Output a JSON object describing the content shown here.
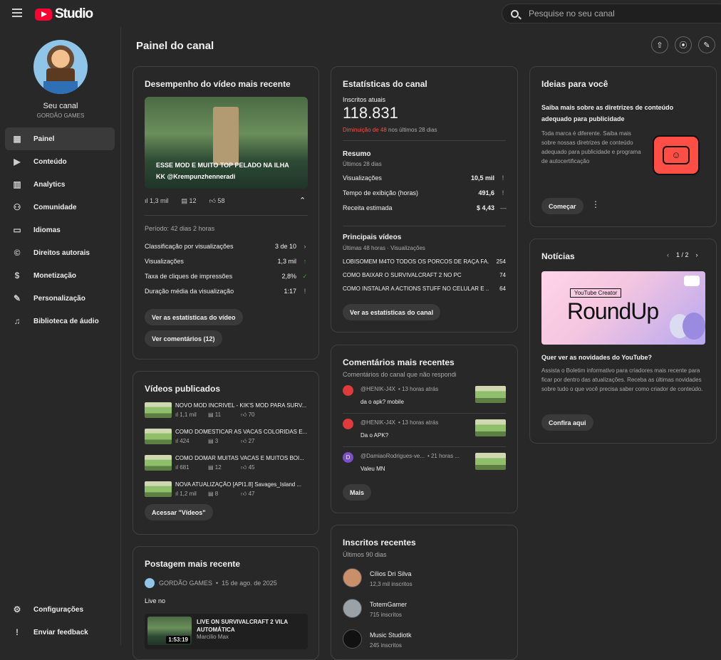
{
  "app": {
    "logo_text": "Studio",
    "search_placeholder": "Pesquise no seu canal"
  },
  "sidebar": {
    "channel_label": "Seu canal",
    "channel_name": "GORDÃO GAMES",
    "items": [
      {
        "label": "Painel",
        "icon": "dashboard-icon",
        "glyph": "▦",
        "active": true
      },
      {
        "label": "Conteúdo",
        "icon": "content-icon",
        "glyph": "▶"
      },
      {
        "label": "Analytics",
        "icon": "analytics-icon",
        "glyph": "▥"
      },
      {
        "label": "Comunidade",
        "icon": "community-icon",
        "glyph": "⚇"
      },
      {
        "label": "Idiomas",
        "icon": "subtitles-icon",
        "glyph": "▭"
      },
      {
        "label": "Direitos autorais",
        "icon": "copyright-icon",
        "glyph": "©"
      },
      {
        "label": "Monetização",
        "icon": "dollar-icon",
        "glyph": "$"
      },
      {
        "label": "Personalização",
        "icon": "magic-wand-icon",
        "glyph": "✎"
      },
      {
        "label": "Biblioteca de áudio",
        "icon": "audio-library-icon",
        "glyph": "♫"
      }
    ],
    "bottom_items": [
      {
        "label": "Configurações",
        "icon": "gear-icon",
        "glyph": "⚙"
      },
      {
        "label": "Enviar feedback",
        "icon": "feedback-icon",
        "glyph": "!"
      }
    ]
  },
  "page": {
    "title": "Painel do canal"
  },
  "latest_video": {
    "title": "Desempenho do vídeo mais recente",
    "video_title": "ESSE MOD E MUITO TOP PELADO NA ILHA KK @Krempunzhenneradi",
    "views": "1,3 mil",
    "comments": "12",
    "likes": "58",
    "period": "Período: 42 dias 2 horas",
    "rows": [
      {
        "label": "Classificação por visualizações",
        "value": "3 de 10",
        "ind": "›"
      },
      {
        "label": "Visualizações",
        "value": "1,3 mil",
        "ind": "↑"
      },
      {
        "label": "Taxa de cliques de impressões",
        "value": "2,8%",
        "ind": "✓"
      },
      {
        "label": "Duração média da visualização",
        "value": "1:17",
        "ind": "!"
      }
    ],
    "btn_stats": "Ver as estatísticas do vídeo",
    "btn_comments": "Ver comentários (12)"
  },
  "published": {
    "title": "Vídeos publicados",
    "videos": [
      {
        "title": "NOVO MOD INCRIVEL - KIK'S MOD PARA SURV...",
        "views": "1,1 mil",
        "comments": "11",
        "likes": "70"
      },
      {
        "title": "COMO DOMESTICAR AS VACAS COLORIDAS E...",
        "views": "424",
        "comments": "3",
        "likes": "27"
      },
      {
        "title": "COMO DOMAR MUITAS VACAS E MUITOS BOI...",
        "views": "681",
        "comments": "12",
        "likes": "45"
      },
      {
        "title": "NOVA ATUALIZAÇÃO [API1.8] Savages_Island ...",
        "views": "1,2 mil",
        "comments": "8",
        "likes": "47"
      }
    ],
    "btn": "Acessar \"Vídeos\""
  },
  "latest_post": {
    "title": "Postagem mais recente",
    "author": "GORDÃO GAMES",
    "date": "15 de ago. de 2025",
    "text": "Live no",
    "live_title": "LIVE ON SURVIVALCRAFT 2 VILA AUTOMÁTICA",
    "live_author": "Marcilio Max",
    "duration": "1:53:19"
  },
  "stats": {
    "title": "Estatísticas do canal",
    "subs_label": "Inscritos atuais",
    "subs": "118.831",
    "decrease": "Diminuição de 48",
    "decrease_rest": "nos últimos 28 dias",
    "summary_title": "Resumo",
    "summary_sub": "Últimos 28 dias",
    "summary": [
      {
        "label": "Visualizações",
        "value": "10,5 mil",
        "ind": "!"
      },
      {
        "label": "Tempo de exibição (horas)",
        "value": "491,6",
        "ind": "!"
      },
      {
        "label": "Receita estimada",
        "value": "$ 4,43",
        "ind": "—"
      }
    ],
    "top_title": "Principais vídeos",
    "top_sub": "Últimas 48 horas · Visualizações",
    "top": [
      {
        "label": "LOBISOMEM M4TO TODOS OS PORCOS DE RAÇA FA...",
        "value": "254"
      },
      {
        "label": "COMO BAIXAR O SURVIVALCRAFT 2 NO PC",
        "value": "74"
      },
      {
        "label": "COMO INSTALAR A ACTIONS STUFF NO CELULAR E ...",
        "value": "64"
      }
    ],
    "btn": "Ver as estatísticas do canal"
  },
  "comments": {
    "title": "Comentários mais recentes",
    "sub": "Comentários do canal que não respondi",
    "items": [
      {
        "author": "@HENIK-J4X",
        "time": "• 13 horas atrás",
        "text": "da o apk? mobile",
        "avatar_color": "#e03b3b"
      },
      {
        "author": "@HENIK-J4X",
        "time": "• 13 horas atrás",
        "text": "Da o APK?",
        "avatar_color": "#e03b3b"
      },
      {
        "author": "@DamiaoRodrigues-ve...",
        "time": "• 21 horas ...",
        "text": "Valeu MN",
        "avatar_color": "#7b4fc9",
        "initial": "D"
      }
    ],
    "btn": "Mais"
  },
  "recent_subs": {
    "title": "Inscritos recentes",
    "sub": "Últimos 90 dias",
    "items": [
      {
        "name": "Cílios Dri Silva",
        "count": "12,3 mil inscritos"
      },
      {
        "name": "TotemGamer",
        "count": "715 inscritos"
      },
      {
        "name": "Music Studiotk",
        "count": "245 inscritos"
      }
    ]
  },
  "ideas": {
    "title": "Ideias para você",
    "headline": "Saiba mais sobre as diretrizes de conteúdo adequado para publicidade",
    "body": "Toda marca é diferente. Saiba mais sobre nossas diretrizes de conteúdo adequado para publicidade e programa de autocertificação",
    "btn": "Começar"
  },
  "news": {
    "title": "Notícias",
    "pager": "1 / 2",
    "banner_tag": "YouTube Creator",
    "banner_title": "RoundUp",
    "headline": "Quer ver as novidades do YouTube?",
    "body": "Assista o Boletim informativo para criadores mais recente para ficar por dentro das atualizações. Receba as últimas novidades sobre tudo o que você precisa saber como criador de conteúdo.",
    "btn": "Confira aqui"
  }
}
